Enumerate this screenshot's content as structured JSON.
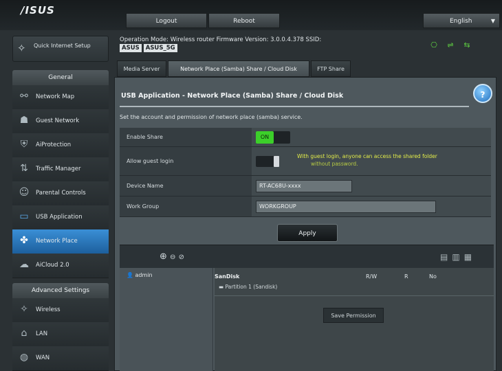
{
  "header": {
    "logo": "/ISUS",
    "logout_label": "Logout",
    "reboot_label": "Reboot",
    "language_label": "English"
  },
  "sidebar": {
    "quick_setup": "Quick Internet Setup",
    "general_header": "General",
    "general_items": [
      {
        "label": "Network Map",
        "icon": "network-map-icon"
      },
      {
        "label": "Guest Network",
        "icon": "guest-network-icon"
      },
      {
        "label": "AiProtection",
        "icon": "aiprotection-icon"
      },
      {
        "label": "Traffic Manager",
        "icon": "traffic-manager-icon"
      },
      {
        "label": "Parental Controls",
        "icon": "parental-controls-icon"
      },
      {
        "label": "USB Application",
        "icon": "usb-application-icon"
      },
      {
        "label": "Network Place",
        "icon": "network-place-icon"
      },
      {
        "label": "AiCloud 2.0",
        "icon": "aicloud-icon"
      }
    ],
    "active_index": 6,
    "advanced_header": "Advanced Settings",
    "advanced_items": [
      {
        "label": "Wireless",
        "icon": "wireless-icon"
      },
      {
        "label": "LAN",
        "icon": "lan-icon"
      },
      {
        "label": "WAN",
        "icon": "wan-icon"
      }
    ]
  },
  "status_bar": {
    "operation_mode": "Operation Mode: Wireless router Firmware Version: 3.0.0.4.378 SSID:",
    "ssid_1": "ASUS",
    "ssid_2": "ASUS_5G"
  },
  "tabs": [
    {
      "label": "Media Server"
    },
    {
      "label": "Network Place (Samba) Share / Cloud Disk"
    },
    {
      "label": "FTP Share"
    }
  ],
  "panel": {
    "title": "USB Application - Network Place (Samba) Share / Cloud Disk",
    "description": "Set the account and permission of network place (samba) service.",
    "help_icon": "?"
  },
  "form": {
    "enable_share_label": "Enable Share",
    "enable_share_value": "ON",
    "guest_login_label": "Allow guest login",
    "guest_login_warning": "With guest login, anyone can access the shared folder",
    "guest_login_more": "without password.",
    "server_name_label": "Device Name",
    "server_name_value": "RT-AC68U-xxxx",
    "work_group_label": "Work Group",
    "work_group_value": "WORKGROUP"
  },
  "apply_label": "Apply",
  "browser": {
    "user_label": "admin",
    "folder_name": "SanDisk",
    "folder_sub": "Partition 1 (Sandisk)",
    "col_r": "R/W",
    "col_w": "R",
    "col_no": "No",
    "action_label": "Save Permission"
  }
}
